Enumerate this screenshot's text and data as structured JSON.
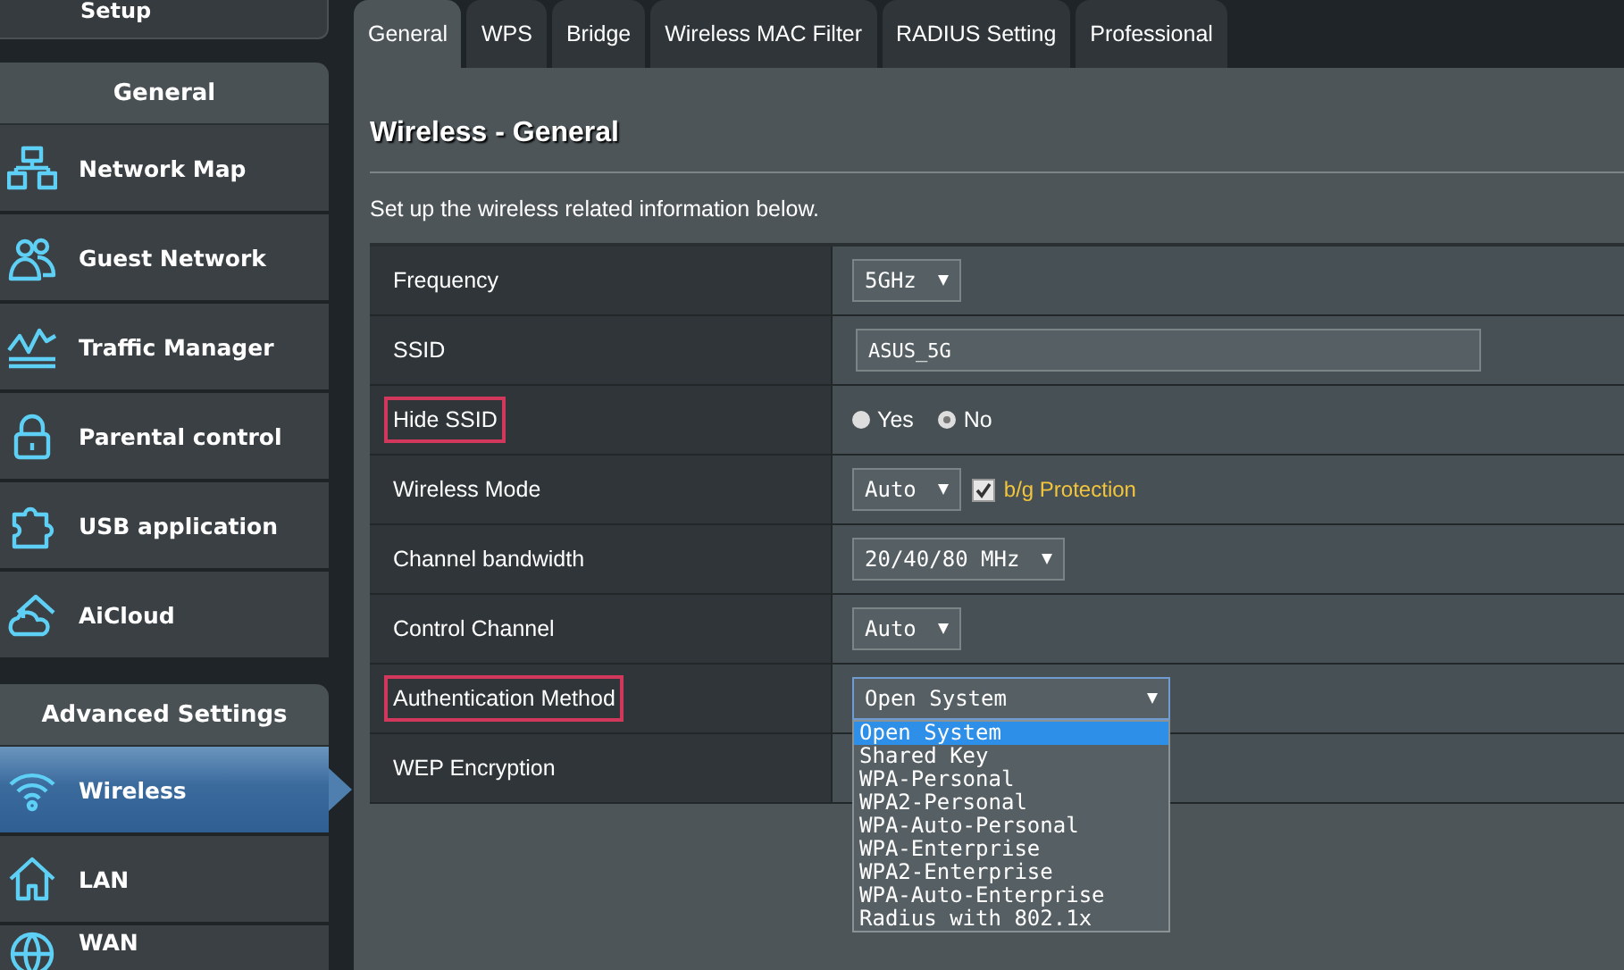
{
  "sidebar": {
    "top_item": {
      "label": "Setup"
    },
    "sections": [
      {
        "header": "General",
        "items": [
          {
            "label": "Network Map",
            "selected": false
          },
          {
            "label": "Guest Network",
            "selected": false
          },
          {
            "label": "Traffic Manager",
            "selected": false
          },
          {
            "label": "Parental control",
            "selected": false
          },
          {
            "label": "USB application",
            "selected": false
          },
          {
            "label": "AiCloud",
            "selected": false
          }
        ]
      },
      {
        "header": "Advanced Settings",
        "items": [
          {
            "label": "Wireless",
            "selected": true
          },
          {
            "label": "LAN",
            "selected": false
          },
          {
            "label": "WAN",
            "selected": false
          }
        ]
      }
    ]
  },
  "tabs": [
    {
      "label": "General",
      "selected": true
    },
    {
      "label": "WPS",
      "selected": false
    },
    {
      "label": "Bridge",
      "selected": false
    },
    {
      "label": "Wireless MAC Filter",
      "selected": false
    },
    {
      "label": "RADIUS Setting",
      "selected": false
    },
    {
      "label": "Professional",
      "selected": false
    }
  ],
  "title": "Wireless - General",
  "description": "Set up the wireless related information below.",
  "settings": [
    {
      "kind": "select",
      "label": "Frequency",
      "highlighted": false,
      "value": "5GHz"
    },
    {
      "kind": "text",
      "label": "SSID",
      "highlighted": false,
      "value": "ASUS_5G"
    },
    {
      "kind": "radio",
      "label": "Hide SSID",
      "highlighted": true,
      "options": [
        {
          "label": "Yes",
          "selected": false
        },
        {
          "label": "No",
          "selected": true
        }
      ]
    },
    {
      "kind": "select",
      "label": "Wireless Mode",
      "highlighted": false,
      "value": "Auto",
      "checkbox": {
        "label": "b/g Protection",
        "checked": true
      }
    },
    {
      "kind": "select",
      "label": "Channel bandwidth",
      "highlighted": false,
      "value": "20/40/80 MHz"
    },
    {
      "kind": "select",
      "label": "Control Channel",
      "highlighted": false,
      "value": "Auto"
    },
    {
      "kind": "select",
      "label": "Authentication Method",
      "highlighted": true,
      "value": "Open System",
      "expanded": true,
      "options": [
        {
          "label": "Open System",
          "selected": true
        },
        {
          "label": "Shared Key",
          "selected": false
        },
        {
          "label": "WPA-Personal",
          "selected": false
        },
        {
          "label": "WPA2-Personal",
          "selected": false
        },
        {
          "label": "WPA-Auto-Personal",
          "selected": false
        },
        {
          "label": "WPA-Enterprise",
          "selected": false
        },
        {
          "label": "WPA2-Enterprise",
          "selected": false
        },
        {
          "label": "WPA-Auto-Enterprise",
          "selected": false
        },
        {
          "label": "Radius with 802.1x",
          "selected": false
        }
      ]
    },
    {
      "kind": "empty",
      "label": "WEP Encryption",
      "highlighted": false
    }
  ]
}
